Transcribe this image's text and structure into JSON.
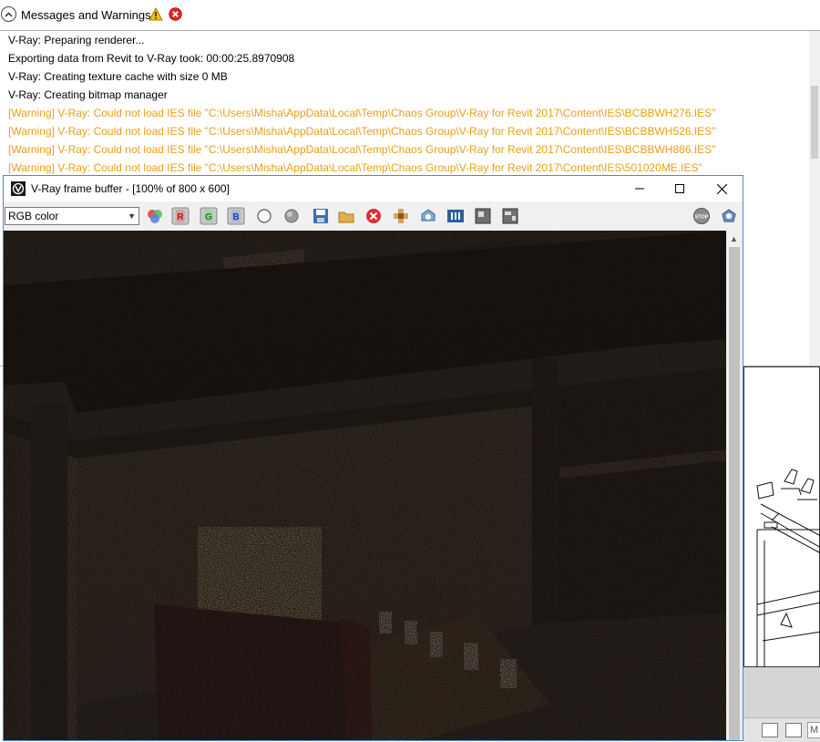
{
  "messages_panel": {
    "title": "Messages and Warnings",
    "lines": [
      {
        "text": "V-Ray: Preparing renderer...",
        "type": "info"
      },
      {
        "text": "Exporting data from Revit to V-Ray took: 00:00:25.8970908",
        "type": "info"
      },
      {
        "text": "V-Ray: Creating texture cache with size 0 MB",
        "type": "info"
      },
      {
        "text": "V-Ray: Creating bitmap manager",
        "type": "info"
      },
      {
        "text": "[Warning] V-Ray: Could not load IES file \"C:\\Users\\Misha\\AppData\\Local\\Temp\\Chaos Group\\V-Ray for Revit 2017\\Content\\IES\\BCBBWH276.IES\"",
        "type": "warning"
      },
      {
        "text": "[Warning] V-Ray: Could not load IES file \"C:\\Users\\Misha\\AppData\\Local\\Temp\\Chaos Group\\V-Ray for Revit 2017\\Content\\IES\\BCBBWH526.IES\"",
        "type": "warning"
      },
      {
        "text": "[Warning] V-Ray: Could not load IES file \"C:\\Users\\Misha\\AppData\\Local\\Temp\\Chaos Group\\V-Ray for Revit 2017\\Content\\IES\\BCBBWH886.IES\"",
        "type": "warning"
      },
      {
        "text": "[Warning] V-Ray: Could not load IES file \"C:\\Users\\Misha\\AppData\\Local\\Temp\\Chaos Group\\V-Ray for Revit 2017\\Content\\IES\\501020ME.IES\"",
        "type": "warning"
      }
    ],
    "warning_color": "#e8a01b"
  },
  "frame_buffer": {
    "title": "V-Ray frame buffer - [100% of 800 x 600]",
    "channel": "RGB color",
    "toolbar_icons": [
      "color-corrections-icon",
      "red-channel-icon",
      "green-channel-icon",
      "blue-channel-icon",
      "mono-icon",
      "alpha-icon",
      "save-image-icon",
      "load-image-icon",
      "clear-image-icon",
      "follow-mouse-icon",
      "region-render-icon",
      "history-icon",
      "pixel-info-icon",
      "lens-effects-icon",
      "stop-render-icon",
      "render-icon"
    ],
    "channel_letters": {
      "r": "R",
      "g": "G",
      "b": "B"
    },
    "stop_label": "STOP"
  },
  "revit_status": {
    "field_text": "M"
  }
}
